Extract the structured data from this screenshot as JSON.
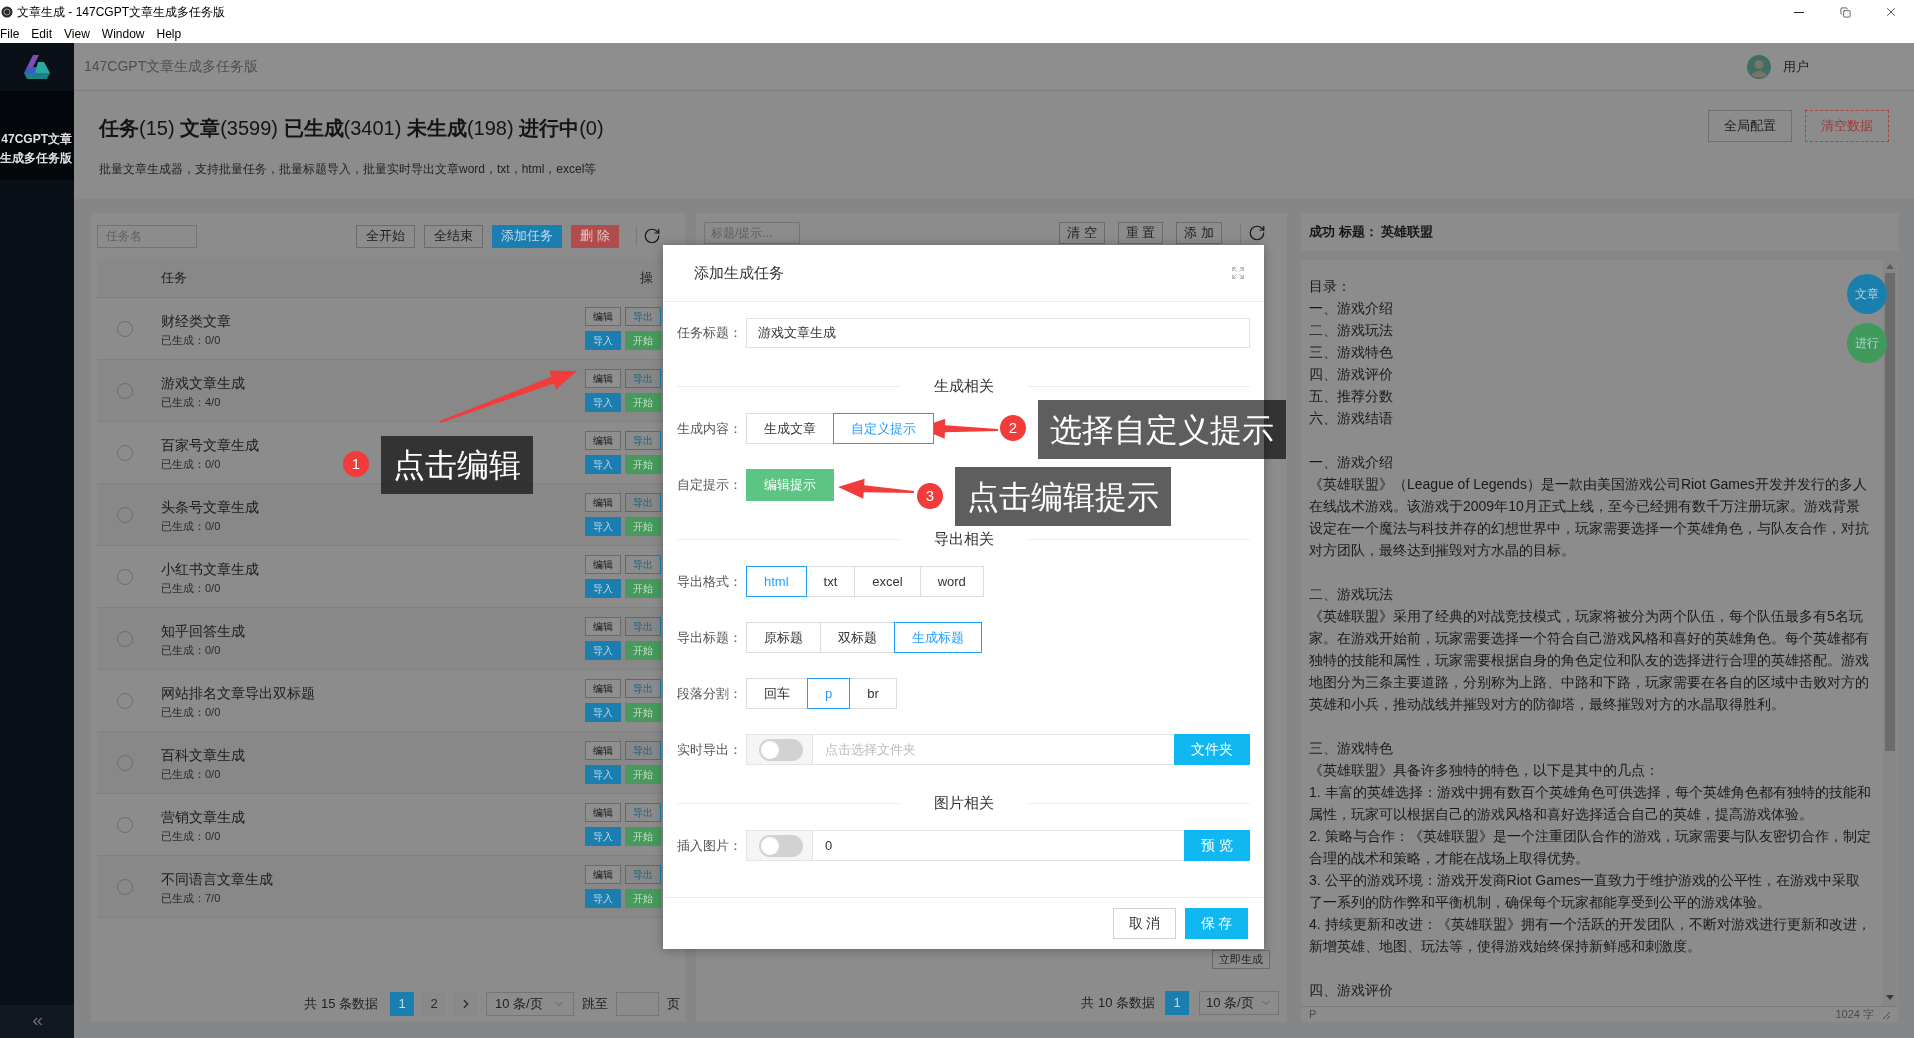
{
  "window": {
    "title": "文章生成 - 147CGPT文章生成多任务版",
    "menu": [
      "File",
      "Edit",
      "View",
      "Window",
      "Help"
    ]
  },
  "sidebar": {
    "brand_lines": [
      "47CGPT文章",
      "生成多任务版"
    ]
  },
  "topbar": {
    "app_name": "147CGPT文章生成多任务版",
    "user": "用户"
  },
  "header": {
    "title": "**任务**(15) **文章**(3599) **已生成**(3401) **未生成**(198) **进行中**(0)",
    "subtitle": "批量文章生成器，支持批量任务，批量标题导入，批量实时导出文章word，txt，html，excel等",
    "buttons": [
      {
        "label": "全局配置",
        "kind": "default"
      },
      {
        "label": "清空数据",
        "kind": "danger"
      }
    ]
  },
  "task_panel": {
    "search_placeholder": "任务名",
    "buttons": [
      {
        "label": "全开始",
        "kind": "default"
      },
      {
        "label": "全结束",
        "kind": "default"
      },
      {
        "label": "添加任务",
        "kind": "primary"
      },
      {
        "label": "删 除",
        "kind": "danger"
      }
    ],
    "columns": [
      "任务",
      "操"
    ],
    "rows": [
      {
        "name": "财经类文章",
        "generated": "已生成：0/0",
        "selected": false,
        "actions": [
          {
            "label": "编辑",
            "kind": "default"
          },
          {
            "label": "导出",
            "kind": "outline"
          },
          {
            "label": "导入",
            "kind": "primary"
          },
          {
            "label": "开始",
            "kind": "success"
          }
        ]
      },
      {
        "name": "游戏文章生成",
        "generated": "已生成：4/0",
        "selected": false,
        "actions": [
          {
            "label": "编辑",
            "kind": "default"
          },
          {
            "label": "导出",
            "kind": "outline"
          },
          {
            "label": "导入",
            "kind": "primary"
          },
          {
            "label": "开始",
            "kind": "success"
          }
        ]
      },
      {
        "name": "百家号文章生成",
        "generated": "已生成：0/0",
        "selected": false,
        "actions": [
          {
            "label": "编辑",
            "kind": "default"
          },
          {
            "label": "导出",
            "kind": "outline"
          },
          {
            "label": "导入",
            "kind": "primary"
          },
          {
            "label": "开始",
            "kind": "success"
          }
        ]
      },
      {
        "name": "头条号文章生成",
        "generated": "已生成：0/0",
        "selected": false,
        "actions": [
          {
            "label": "编辑",
            "kind": "default"
          },
          {
            "label": "导出",
            "kind": "outline"
          },
          {
            "label": "导入",
            "kind": "primary"
          },
          {
            "label": "开始",
            "kind": "success"
          }
        ]
      },
      {
        "name": "小红书文章生成",
        "generated": "已生成：0/0",
        "selected": false,
        "actions": [
          {
            "label": "编辑",
            "kind": "default"
          },
          {
            "label": "导出",
            "kind": "outline"
          },
          {
            "label": "导入",
            "kind": "primary"
          },
          {
            "label": "开始",
            "kind": "success"
          }
        ]
      },
      {
        "name": "知乎回答生成",
        "generated": "已生成：0/0",
        "selected": false,
        "actions": [
          {
            "label": "编辑",
            "kind": "default"
          },
          {
            "label": "导出",
            "kind": "outline"
          },
          {
            "label": "导入",
            "kind": "primary"
          },
          {
            "label": "开始",
            "kind": "success"
          }
        ]
      },
      {
        "name": "网站排名文章导出双标题",
        "generated": "已生成：0/0",
        "selected": false,
        "actions": [
          {
            "label": "编辑",
            "kind": "default"
          },
          {
            "label": "导出",
            "kind": "outline"
          },
          {
            "label": "导入",
            "kind": "primary"
          },
          {
            "label": "开始",
            "kind": "success"
          }
        ]
      },
      {
        "name": "百科文章生成",
        "generated": "已生成：0/0",
        "selected": false,
        "actions": [
          {
            "label": "编辑",
            "kind": "default"
          },
          {
            "label": "导出",
            "kind": "outline"
          },
          {
            "label": "导入",
            "kind": "primary"
          },
          {
            "label": "开始",
            "kind": "success"
          }
        ]
      },
      {
        "name": "营销文章生成",
        "generated": "已生成：0/0",
        "selected": false,
        "actions": [
          {
            "label": "编辑",
            "kind": "default"
          },
          {
            "label": "导出",
            "kind": "outline"
          },
          {
            "label": "导入",
            "kind": "primary"
          },
          {
            "label": "开始",
            "kind": "success"
          }
        ]
      },
      {
        "name": "不同语言文章生成",
        "generated": "已生成：7/0",
        "selected": false,
        "actions": [
          {
            "label": "编辑",
            "kind": "default"
          },
          {
            "label": "导出",
            "kind": "outline"
          },
          {
            "label": "导入",
            "kind": "primary"
          },
          {
            "label": "开始",
            "kind": "success"
          }
        ]
      }
    ],
    "pagination": {
      "total": "共 15 条数据",
      "pages": [
        {
          "label": "1",
          "selected": true
        },
        {
          "label": "2",
          "selected": false
        }
      ],
      "page_size": "10 条/页",
      "jump_label": "跳至",
      "page_suffix": "页"
    }
  },
  "prompt_panel": {
    "search_placeholder": "标题/提示...",
    "buttons": [
      "清 空",
      "重 置",
      "添 加"
    ],
    "generate_button": "立即生成",
    "pagination": {
      "total": "共 10 条数据",
      "pages": [
        {
          "label": "1",
          "selected": true
        }
      ],
      "page_size": "10 条/页"
    }
  },
  "result_panel": {
    "title": "成功 标题： 英雄联盟",
    "float_buttons": [
      {
        "label": "文章",
        "color": "#1b7fae"
      },
      {
        "label": "进行",
        "color": "#3f9a5c"
      }
    ],
    "blocks": [
      [
        "目录：",
        "一、游戏介绍",
        "二、游戏玩法",
        "三、游戏特色",
        "四、游戏评价",
        "五、推荐分数",
        "六、游戏结语"
      ],
      [
        "一、游戏介绍",
        "《英雄联盟》（League of Legends）是一款由美国游戏公司Riot Games开发并发行的多人在线战术游戏。该游戏于2009年10月正式上线，至今已经拥有数千万注册玩家。游戏背景设定在一个魔法与科技并存的幻想世界中，玩家需要选择一个英雄角色，与队友合作，对抗对方团队，最终达到摧毁对方水晶的目标。"
      ],
      [
        "二、游戏玩法",
        "《英雄联盟》采用了经典的对战竞技模式，玩家将被分为两个队伍，每个队伍最多有5名玩家。在游戏开始前，玩家需要选择一个符合自己游戏风格和喜好的英雄角色。每个英雄都有独特的技能和属性，玩家需要根据自身的角色定位和队友的选择进行合理的英雄搭配。游戏地图分为三条主要道路，分别称为上路、中路和下路，玩家需要在各自的区域中击败对方的英雄和小兵，推动战线并摧毁对方的防御塔，最终摧毁对方的水晶取得胜利。"
      ],
      [
        "三、游戏特色",
        "《英雄联盟》具备许多独特的特色，以下是其中的几点：",
        "1. 丰富的英雄选择：游戏中拥有数百个英雄角色可供选择，每个英雄角色都有独特的技能和属性，玩家可以根据自己的游戏风格和喜好选择适合自己的英雄，提高游戏体验。",
        "2. 策略与合作：《英雄联盟》是一个注重团队合作的游戏，玩家需要与队友密切合作，制定合理的战术和策略，才能在战场上取得优势。",
        "3. 公平的游戏环境：游戏开发商Riot Games一直致力于维护游戏的公平性，在游戏中采取了一系列的防作弊和平衡机制，确保每个玩家都能享受到公平的游戏体验。",
        "4. 持续更新和改进：《英雄联盟》拥有一个活跃的开发团队，不断对游戏进行更新和改进，新增英雄、地图、玩法等，使得游戏始终保持新鲜感和刺激度。"
      ],
      [
        "四、游戏评价"
      ]
    ],
    "status_tag": "P",
    "word_count": "1024 字"
  },
  "dialog": {
    "title": "添加生成任务",
    "items": [
      {
        "kind": "input",
        "label": "任务标题：",
        "value": "游戏文章生成"
      },
      {
        "kind": "section",
        "label": "生成相关"
      },
      {
        "kind": "segmented",
        "label": "生成内容：",
        "options": [
          {
            "label": "生成文章",
            "selected": false
          },
          {
            "label": "自定义提示",
            "selected": true
          }
        ]
      },
      {
        "kind": "action",
        "label": "自定提示：",
        "button": "编辑提示"
      },
      {
        "kind": "section",
        "label": "导出相关"
      },
      {
        "kind": "segmented",
        "label": "导出格式：",
        "options": [
          {
            "label": "html",
            "selected": true
          },
          {
            "label": "txt",
            "selected": false
          },
          {
            "label": "excel",
            "selected": false
          },
          {
            "label": "word",
            "selected": false
          }
        ]
      },
      {
        "kind": "segmented",
        "label": "导出标题：",
        "options": [
          {
            "label": "原标题",
            "selected": false
          },
          {
            "label": "双标题",
            "selected": false
          },
          {
            "label": "生成标题",
            "selected": true
          }
        ]
      },
      {
        "kind": "segmented",
        "label": "段落分割：",
        "options": [
          {
            "label": "回车",
            "selected": false
          },
          {
            "label": "p",
            "selected": true
          },
          {
            "label": "br",
            "selected": false
          }
        ]
      },
      {
        "kind": "switch_input",
        "label": "实时导出：",
        "on": false,
        "placeholder": "点击选择文件夹",
        "button": "文件夹"
      },
      {
        "kind": "section",
        "label": "图片相关"
      },
      {
        "kind": "switch_input",
        "label": "插入图片：",
        "on": false,
        "value": "0",
        "button": "预 览"
      }
    ],
    "buttons": [
      {
        "label": "取 消",
        "kind": "default"
      },
      {
        "label": "保 存",
        "kind": "primary"
      }
    ]
  },
  "annotations": [
    {
      "number": "1",
      "text": "点击编辑"
    },
    {
      "number": "2",
      "text": "选择自定义提示"
    },
    {
      "number": "3",
      "text": "点击编辑提示"
    }
  ]
}
